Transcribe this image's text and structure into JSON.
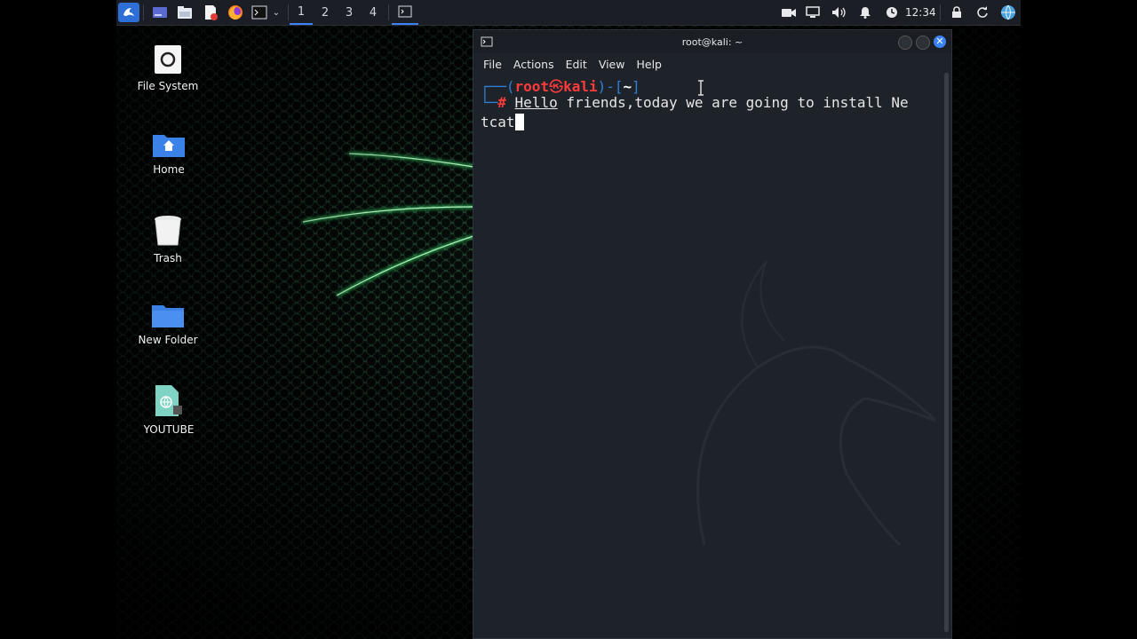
{
  "taskbar": {
    "workspaces": [
      "1",
      "2",
      "3",
      "4"
    ],
    "active_workspace": "1",
    "clock": "12:34",
    "apps": [
      "kali-menu-icon",
      "workspace-preview-icon",
      "file-manager-icon",
      "text-editor-icon",
      "firefox-icon",
      "terminal-icon"
    ]
  },
  "desktop": {
    "icons": [
      {
        "label": "File System",
        "icon": "drive-icon"
      },
      {
        "label": "Home",
        "icon": "home-folder-icon"
      },
      {
        "label": "Trash",
        "icon": "trash-icon"
      },
      {
        "label": "New Folder",
        "icon": "folder-icon"
      },
      {
        "label": "YOUTUBE",
        "icon": "html-file-icon"
      }
    ]
  },
  "terminal": {
    "title": "root@kali: ~",
    "menu": [
      "File",
      "Actions",
      "Edit",
      "View",
      "Help"
    ],
    "prompt_user": "root",
    "prompt_symbol": "㉿",
    "prompt_host": "kali",
    "prompt_dir": "~",
    "prompt_hash": "#",
    "command_first_word": "Hello",
    "command_rest": " friends,today we are going to install Ne",
    "command_wrap": "tcat"
  },
  "colors": {
    "accent": "#3b82f6",
    "prompt_red": "#ff3b3b",
    "prompt_blue": "#2f7fd8",
    "terminal_bg": "#1e232a"
  }
}
